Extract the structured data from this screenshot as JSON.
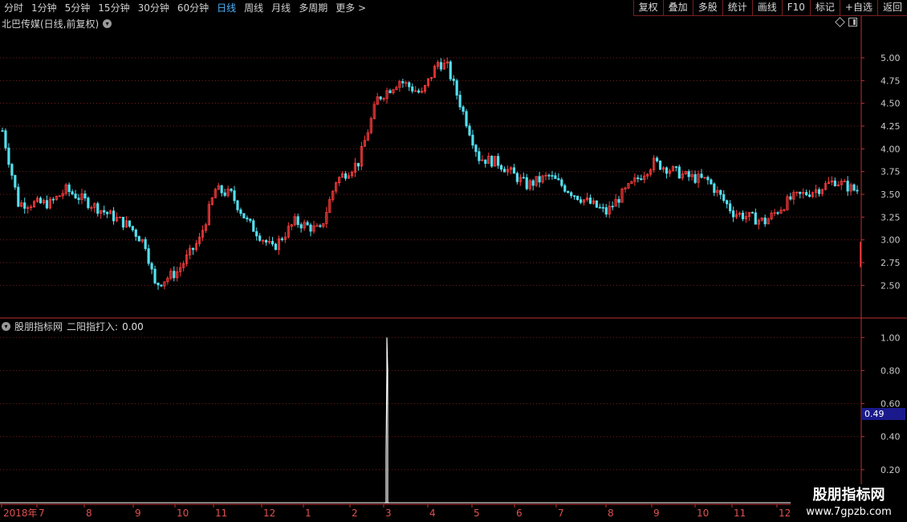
{
  "toolbar": {
    "periods": [
      "分时",
      "1分钟",
      "5分钟",
      "15分钟",
      "30分钟",
      "60分钟",
      "日线",
      "周线",
      "月线",
      "多周期",
      "更多 >"
    ],
    "active_period": "日线",
    "actions": [
      "复权",
      "叠加",
      "多股",
      "统计",
      "画线",
      "F10",
      "标记",
      "+自选",
      "返回"
    ]
  },
  "stock": {
    "title": "北巴传媒(日线,前复权)",
    "dropdown_icon": "chevron-down-icon"
  },
  "indicator": {
    "source": "股朋指标网",
    "label": "二阳指打入:",
    "value": "0.00",
    "cursor_price": "0.49"
  },
  "watermark": {
    "name": "股朋指标网",
    "url": "www.7gpzb.com"
  },
  "colors": {
    "up": "#ff3c3c",
    "down": "#54e0f0",
    "grid": "#7a1f1f",
    "axis": "#c03030",
    "indicator": "#ffffff"
  },
  "chart_data": [
    {
      "type": "candlestick",
      "title": "北巴传媒(日线,前复权)",
      "y_ticks": [
        "5.00",
        "4.75",
        "4.50",
        "4.25",
        "4.00",
        "3.75",
        "3.50",
        "3.25",
        "3.00",
        "2.75",
        "2.50"
      ],
      "ylim": [
        2.15,
        5.3
      ],
      "x_labels": [
        "2018年",
        "7",
        "8",
        "9",
        "10",
        "11",
        "12",
        "1",
        "2",
        "3",
        "4",
        "5",
        "6",
        "7",
        "8",
        "9",
        "10",
        "11",
        "12"
      ],
      "trend_keypoints": [
        [
          0,
          4.2
        ],
        [
          5,
          3.4
        ],
        [
          15,
          3.4
        ],
        [
          20,
          3.55
        ],
        [
          35,
          3.25
        ],
        [
          40,
          3.15
        ],
        [
          45,
          2.95
        ],
        [
          48,
          2.5
        ],
        [
          55,
          2.65
        ],
        [
          62,
          3.0
        ],
        [
          67,
          3.55
        ],
        [
          72,
          3.5
        ],
        [
          77,
          3.2
        ],
        [
          85,
          2.9
        ],
        [
          92,
          3.2
        ],
        [
          100,
          3.1
        ],
        [
          105,
          3.65
        ],
        [
          112,
          3.85
        ],
        [
          118,
          4.55
        ],
        [
          125,
          4.75
        ],
        [
          132,
          4.6
        ],
        [
          137,
          4.95
        ],
        [
          140,
          4.9
        ],
        [
          146,
          4.3
        ],
        [
          150,
          3.9
        ],
        [
          156,
          3.85
        ],
        [
          165,
          3.6
        ],
        [
          172,
          3.7
        ],
        [
          180,
          3.5
        ],
        [
          190,
          3.3
        ],
        [
          195,
          3.5
        ],
        [
          205,
          3.85
        ],
        [
          215,
          3.7
        ],
        [
          222,
          3.65
        ],
        [
          230,
          3.3
        ],
        [
          240,
          3.2
        ],
        [
          248,
          3.45
        ],
        [
          256,
          3.55
        ],
        [
          262,
          3.65
        ],
        [
          268,
          3.55
        ]
      ],
      "last_price_range": [
        2.7,
        2.98
      ]
    },
    {
      "type": "line",
      "title": "二阳指打入",
      "y_ticks": [
        "1.00",
        "0.80",
        "0.60",
        "0.40",
        "0.20"
      ],
      "ylim": [
        0,
        1.05
      ],
      "spike": {
        "x_label": "3",
        "value": 1.0
      }
    }
  ]
}
